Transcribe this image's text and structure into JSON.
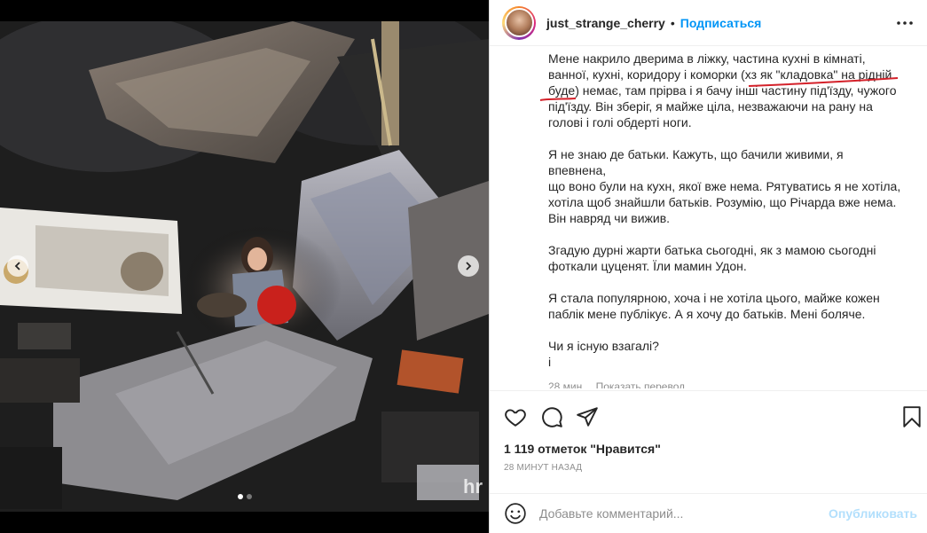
{
  "post": {
    "username": "just_strange_cherry",
    "separator": "•",
    "follow_label": "Подписаться",
    "caption": {
      "paragraphs": [
        {
          "lines": [
            "Мене накрило дверима в ліжку, частина кухні в кімнаті,",
            "ванної, кухні, коридору і коморки (хз як \"кладовка\" на рідній",
            "буде) немає, там прірва і я бачу інші частину під'їзду, чужого",
            "під'їзду. Він зберіг, я майже ціла, незважаючи на рану на",
            "голові і голі обдерті ноги."
          ]
        },
        {
          "lines": [
            "Я не знаю де батьки. Кажуть, що бачили живими, я впевнена,",
            "що воно були на кухн, якої вже нема. Рятуватись я не хотіла,",
            "хотіла щоб знайшли батьків. Розумію, що Річарда вже нема.",
            "Він навряд чи вижив."
          ]
        },
        {
          "lines": [
            "Згадую дурні жарти батька сьогодні, як з мамою сьогодні",
            "фоткали цуценят. Їли мамин Удон."
          ]
        },
        {
          "lines": [
            "Я стала популярною, хоча і не хотіла цього, майже кожен",
            "паблік мене публікує. А я хочу до батьків. Мені боляче."
          ]
        },
        {
          "lines": [
            "Чи я існую взагалі?",
            "і"
          ]
        }
      ]
    },
    "time_ago": "28 мин.",
    "translate_label": "Показать перевод",
    "likes": "1 119 отметок \"Нравится\"",
    "date": "28 МИНУТ НАЗАД",
    "comment_placeholder": "Добавьте комментарий...",
    "publish_label": "Опубликовать"
  },
  "media": {
    "watermark": "hr",
    "slide_count": 2,
    "active_slide": 1
  },
  "icons": {
    "more": "more-horizontal-icon",
    "like": "heart-icon",
    "comment": "comment-icon",
    "share": "share-icon",
    "save": "bookmark-icon",
    "emoji": "emoji-icon",
    "prev": "chevron-left-icon",
    "next": "chevron-right-icon"
  },
  "colors": {
    "link_blue": "#0095f6",
    "publish_disabled": "#b2dffc",
    "annotation_red": "#d4212a"
  }
}
